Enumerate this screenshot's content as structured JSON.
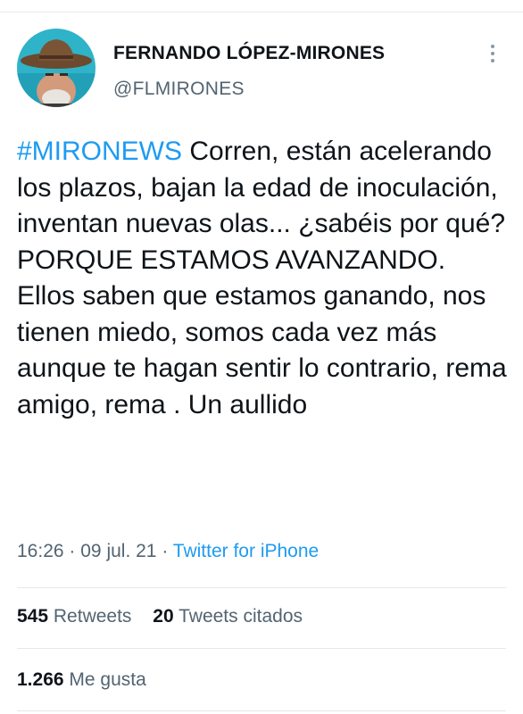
{
  "tweet": {
    "author_name": "FERNANDO LÓPEZ-MIRONES",
    "author_handle": "@FLMIRONES",
    "hashtag": "#MIRONEWS",
    "text": " Corren, están acelerando los plazos, bajan la edad de inoculación, inventan nuevas olas... ¿sabéis por qué? PORQUE ESTAMOS AVANZANDO. Ellos saben que estamos ganando, nos tienen miedo, somos cada vez más aunque te hagan sentir lo contrario, rema amigo, rema . Un aullido",
    "time": "16:26",
    "separator": "·",
    "date": "09 jul. 21",
    "source": "Twitter for iPhone"
  },
  "stats": {
    "retweets_count": "545",
    "retweets_label": "Retweets",
    "quotes_count": "20",
    "quotes_label": "Tweets citados",
    "likes_count": "1.266",
    "likes_label": "Me gusta"
  },
  "icons": {
    "more": "more-vertical-icon",
    "avatar": "avatar-photo"
  },
  "colors": {
    "link": "#1d9bf0",
    "secondary_text": "#536471",
    "primary_text": "#0f1419",
    "divider": "#e1e8ed"
  }
}
